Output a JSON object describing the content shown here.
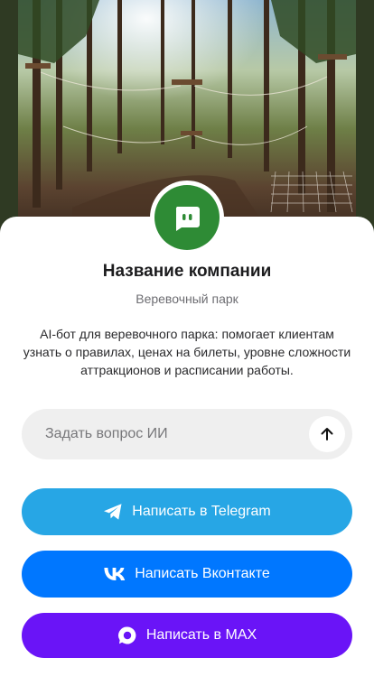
{
  "company": {
    "name": "Название компании",
    "category": "Веревочный парк",
    "description": "AI-бот для веревочного парка: помогает клиентам узнать о правилах, ценах на билеты, уровне сложности аттракционов и расписании работы."
  },
  "ask": {
    "placeholder": "Задать вопрос ИИ",
    "send_icon": "arrow-up-icon"
  },
  "buttons": {
    "telegram_label": "Написать в Telegram",
    "vk_label": "Написать Вконтакте",
    "max_label": "Написать в MAX"
  },
  "colors": {
    "avatar": "#2e8b35",
    "telegram": "#27a6e5",
    "vk": "#0077ff",
    "max": "#6a14f7",
    "input_bg": "#efefef"
  }
}
